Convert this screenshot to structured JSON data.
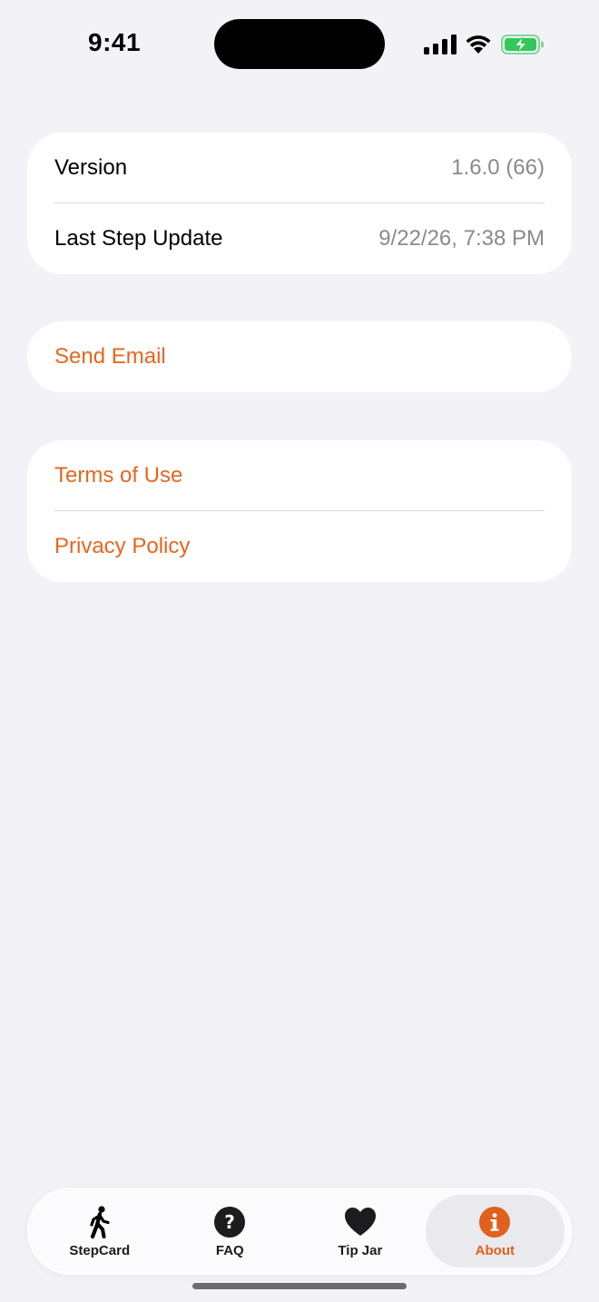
{
  "status_bar": {
    "time": "9:41"
  },
  "info_group": {
    "rows": [
      {
        "label": "Version",
        "value": "1.6.0 (66)"
      },
      {
        "label": "Last Step Update",
        "value": "9/22/26, 7:38 PM"
      }
    ]
  },
  "contact_group": {
    "send_email": "Send Email"
  },
  "legal_group": {
    "terms": "Terms of Use",
    "privacy": "Privacy Policy"
  },
  "tab_bar": {
    "selected": "About",
    "tabs": [
      {
        "label": "StepCard",
        "icon": "walking-figure-icon"
      },
      {
        "label": "FAQ",
        "icon": "question-circle-icon"
      },
      {
        "label": "Tip Jar",
        "icon": "heart-icon"
      },
      {
        "label": "About",
        "icon": "info-circle-icon"
      }
    ]
  },
  "colors": {
    "accent": "#e8651f",
    "background": "#f2f2f7",
    "card": "#ffffff",
    "secondary_text": "#8a8a8e",
    "battery_green": "#34c759"
  }
}
